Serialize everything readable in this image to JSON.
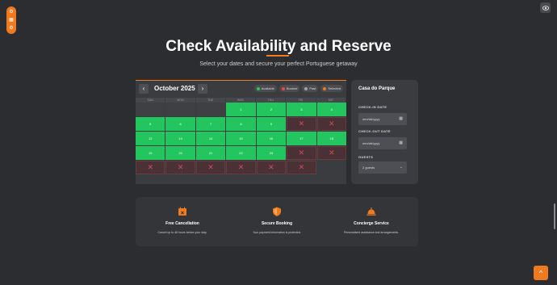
{
  "toolbar": {
    "icons": [
      "gear-icon",
      "grid-icon",
      "settings-icon"
    ]
  },
  "title": "Check Availability and Reserve",
  "subtitle": "Select your dates and secure your perfect Portuguese getaway",
  "calendar": {
    "prev_label": "‹",
    "next_label": "›",
    "month": "October 2025",
    "legend": [
      {
        "label": "Available",
        "color": "#22c55e"
      },
      {
        "label": "Booked",
        "color": "#ef4444"
      },
      {
        "label": "Past",
        "color": "#9ca3af"
      },
      {
        "label": "Selected",
        "color": "#f07a1f"
      }
    ],
    "weekdays": [
      "SUN",
      "MON",
      "TUE",
      "WED",
      "THU",
      "FRI",
      "SAT"
    ],
    "cells": [
      {
        "t": "empty",
        "d": ""
      },
      {
        "t": "empty",
        "d": ""
      },
      {
        "t": "empty",
        "d": ""
      },
      {
        "t": "avail",
        "d": "1"
      },
      {
        "t": "avail",
        "d": "2"
      },
      {
        "t": "avail",
        "d": "3"
      },
      {
        "t": "avail",
        "d": "4"
      },
      {
        "t": "avail",
        "d": "5"
      },
      {
        "t": "avail",
        "d": "6"
      },
      {
        "t": "avail",
        "d": "7"
      },
      {
        "t": "avail",
        "d": "8"
      },
      {
        "t": "avail",
        "d": "9"
      },
      {
        "t": "booked",
        "d": ""
      },
      {
        "t": "booked",
        "d": ""
      },
      {
        "t": "avail",
        "d": "12"
      },
      {
        "t": "avail",
        "d": "13"
      },
      {
        "t": "avail",
        "d": "14"
      },
      {
        "t": "avail",
        "d": "15"
      },
      {
        "t": "avail",
        "d": "16"
      },
      {
        "t": "avail",
        "d": "17"
      },
      {
        "t": "avail",
        "d": "18"
      },
      {
        "t": "avail",
        "d": "19"
      },
      {
        "t": "avail",
        "d": "20"
      },
      {
        "t": "avail",
        "d": "21"
      },
      {
        "t": "avail",
        "d": "22"
      },
      {
        "t": "avail",
        "d": "23"
      },
      {
        "t": "booked",
        "d": ""
      },
      {
        "t": "booked",
        "d": ""
      },
      {
        "t": "booked",
        "d": ""
      },
      {
        "t": "booked",
        "d": ""
      },
      {
        "t": "booked",
        "d": ""
      },
      {
        "t": "booked",
        "d": ""
      },
      {
        "t": "booked",
        "d": ""
      },
      {
        "t": "booked",
        "d": ""
      }
    ]
  },
  "booking": {
    "property": "Casa do Parque",
    "checkin_label": "CHECK-IN DATE",
    "checkin_placeholder": "mm/dd/yyyy",
    "checkout_label": "CHECK-OUT DATE",
    "checkout_placeholder": "mm/dd/yyyy",
    "guests_label": "GUESTS",
    "guests_value": "2 guests"
  },
  "features": [
    {
      "icon": "calendar-x-icon",
      "title": "Free Cancellation",
      "desc": "Cancel up to 48 hours before your stay."
    },
    {
      "icon": "shield-icon",
      "title": "Secure Booking",
      "desc": "Your payment information is protected."
    },
    {
      "icon": "bell-icon",
      "title": "Concierge Service",
      "desc": "Personalised assistance and arrangements."
    }
  ],
  "scroll_top_label": "^",
  "accent": "#f07a1f"
}
